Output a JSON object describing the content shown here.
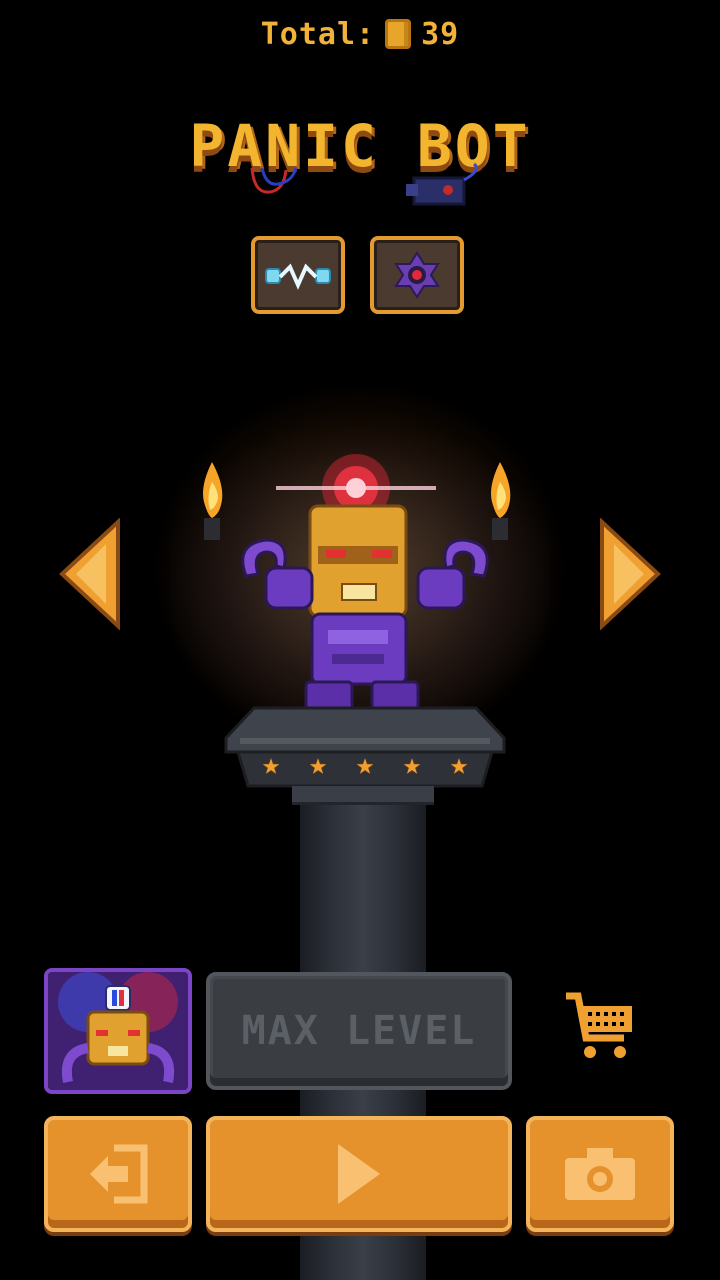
{
  "header": {
    "total_label": "Total:",
    "coins": "39"
  },
  "character": {
    "name": "PANIC BOT",
    "stars": 5,
    "max_stars": 5
  },
  "abilities": [
    {
      "icon": "lightning-link-icon"
    },
    {
      "icon": "red-eye-orb-icon"
    }
  ],
  "buttons": {
    "upgrade_label": "MAX LEVEL",
    "exit_icon": "exit-door-icon",
    "play_icon": "play-icon",
    "camera_icon": "camera-icon",
    "shop_icon": "shopping-cart-icon"
  },
  "colors": {
    "accent": "#e6922c",
    "title": "#f3b42e",
    "disabled": "#3a3d42",
    "portrait_bg": "#5b2e9a"
  }
}
